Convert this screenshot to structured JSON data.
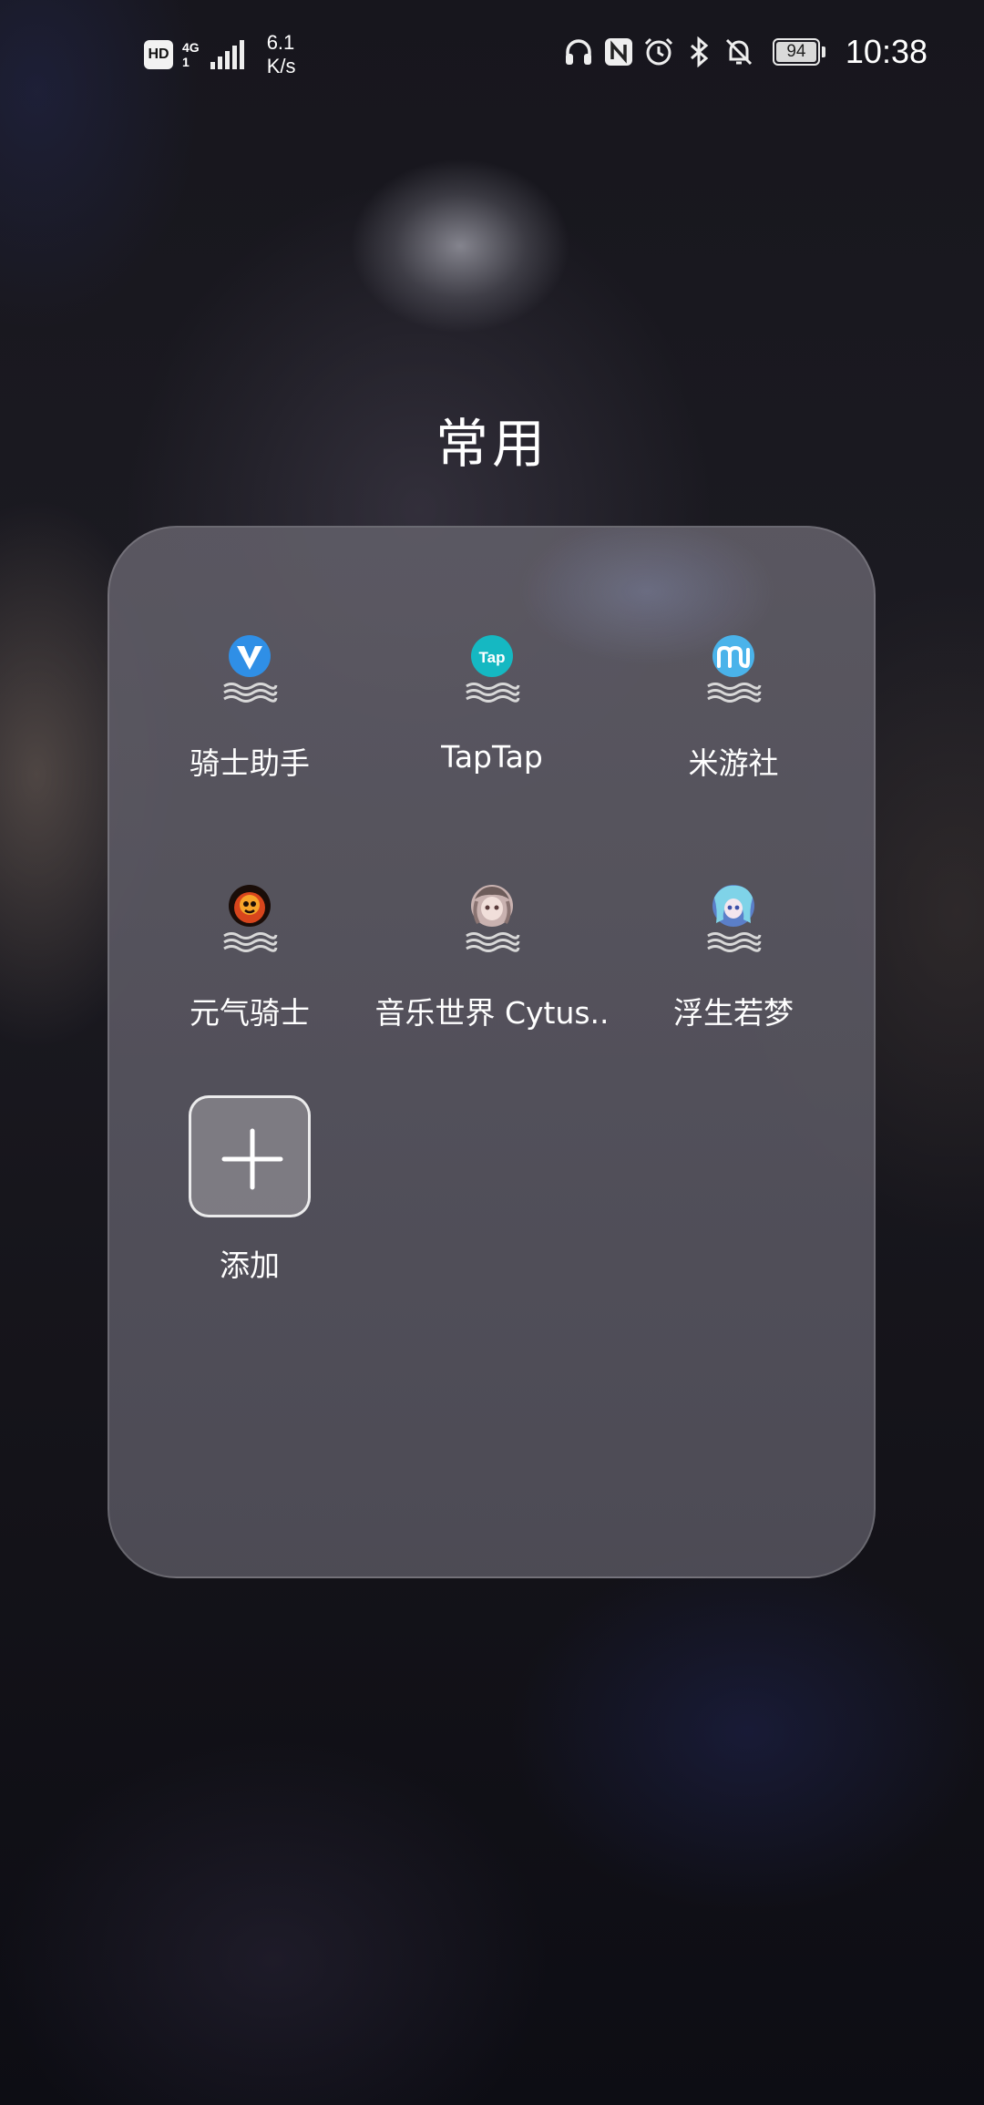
{
  "status_bar": {
    "hd_label": "HD",
    "network_top": "4G",
    "network_bottom": "1",
    "speed_value": "6.1",
    "speed_unit": "K/s",
    "icons": [
      "headphones-icon",
      "nfc-icon",
      "alarm-icon",
      "bluetooth-icon",
      "bell-off-icon",
      "signal-icon"
    ],
    "battery_level": "94",
    "time": "10:38"
  },
  "folder": {
    "title": "常用",
    "apps": [
      {
        "label": "骑士助手",
        "icon": "knight-assistant-icon",
        "color": "#2f8fe6"
      },
      {
        "label": "TapTap",
        "icon": "taptap-icon",
        "color": "#15b8c2",
        "icon_text": "Tap"
      },
      {
        "label": "米游社",
        "icon": "miyoushe-icon",
        "color": "#4ab3ea"
      },
      {
        "label": "元气骑士",
        "icon": "soul-knight-icon",
        "color": "#d8451c"
      },
      {
        "label": "音乐世界 Cytus..",
        "icon": "cytus-icon",
        "color": "#c9b2b0"
      },
      {
        "label": "浮生若梦",
        "icon": "fusheng-icon",
        "color": "#5b7fc9"
      }
    ],
    "add_label": "添加"
  }
}
